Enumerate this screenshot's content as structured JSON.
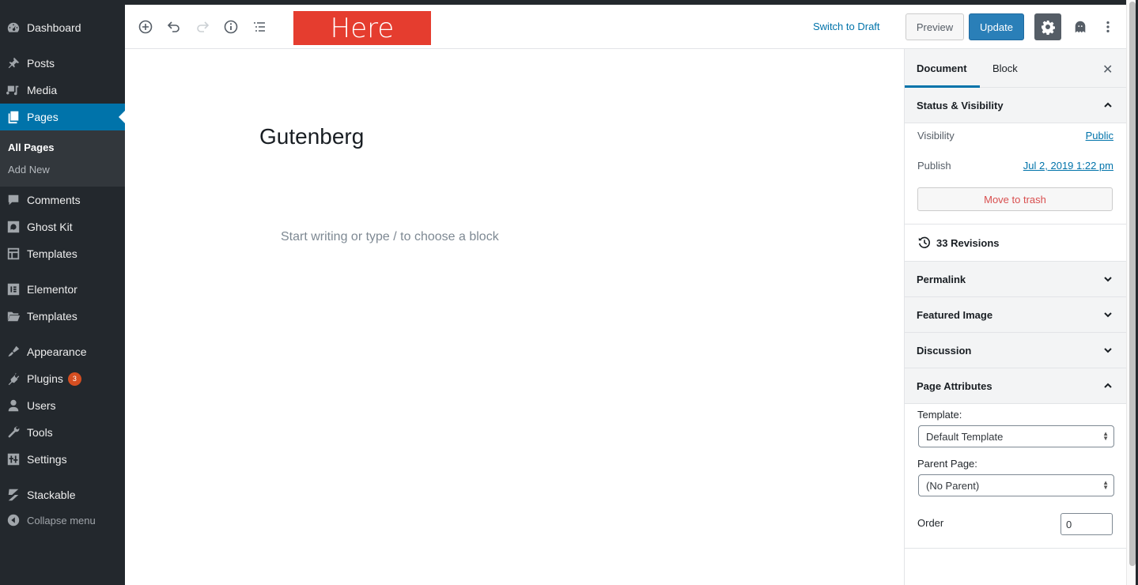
{
  "admin_menu": {
    "items": [
      {
        "label": "Dashboard",
        "icon": "dashboard-icon"
      },
      {
        "label": "Posts",
        "icon": "pin-icon"
      },
      {
        "label": "Media",
        "icon": "media-icon"
      },
      {
        "label": "Pages",
        "icon": "pages-icon",
        "current": true
      },
      {
        "label": "Comments",
        "icon": "comment-icon"
      },
      {
        "label": "Ghost Kit",
        "icon": "ghostkit-icon"
      },
      {
        "label": "Templates",
        "icon": "layout-icon"
      },
      {
        "label": "Elementor",
        "icon": "elementor-icon"
      },
      {
        "label": "Templates",
        "icon": "folder-icon"
      },
      {
        "label": "Appearance",
        "icon": "paintbrush-icon"
      },
      {
        "label": "Plugins",
        "icon": "plugin-icon",
        "badge": "3"
      },
      {
        "label": "Users",
        "icon": "user-icon"
      },
      {
        "label": "Tools",
        "icon": "wrench-icon"
      },
      {
        "label": "Settings",
        "icon": "settings-sliders-icon"
      },
      {
        "label": "Stackable",
        "icon": "stackable-icon"
      }
    ],
    "submenu": [
      {
        "label": "All Pages",
        "current": true
      },
      {
        "label": "Add New"
      }
    ],
    "collapse_label": "Collapse menu"
  },
  "header": {
    "toolbar_icons": [
      "add-block-icon",
      "undo-icon",
      "redo-icon",
      "info-icon",
      "outline-icon"
    ],
    "banner_text": "Here",
    "switch_to_draft": "Switch to Draft",
    "preview": "Preview",
    "update": "Update"
  },
  "editor": {
    "title": "Gutenberg",
    "placeholder": "Start writing or type / to choose a block"
  },
  "sidebar": {
    "tabs": [
      {
        "label": "Document",
        "active": true
      },
      {
        "label": "Block"
      }
    ],
    "status_visibility": {
      "title": "Status & Visibility",
      "visibility_label": "Visibility",
      "visibility_value": "Public",
      "publish_label": "Publish",
      "publish_value": "Jul 2, 2019 1:22 pm",
      "trash_label": "Move to trash"
    },
    "revisions": "33 Revisions",
    "panels": [
      {
        "title": "Permalink",
        "open": false
      },
      {
        "title": "Featured Image",
        "open": false
      },
      {
        "title": "Discussion",
        "open": false
      },
      {
        "title": "Page Attributes",
        "open": true
      }
    ],
    "page_attributes": {
      "template_label": "Template:",
      "template_value": "Default Template",
      "parent_label": "Parent Page:",
      "parent_value": "(No Parent)",
      "order_label": "Order",
      "order_value": "0"
    }
  },
  "colors": {
    "admin_bg": "#23282d",
    "accent": "#0073aa",
    "update_button": "#2a7fb8",
    "banner": "#e53d2f",
    "trash_text": "#d94f4f",
    "badge": "#d54e21"
  }
}
